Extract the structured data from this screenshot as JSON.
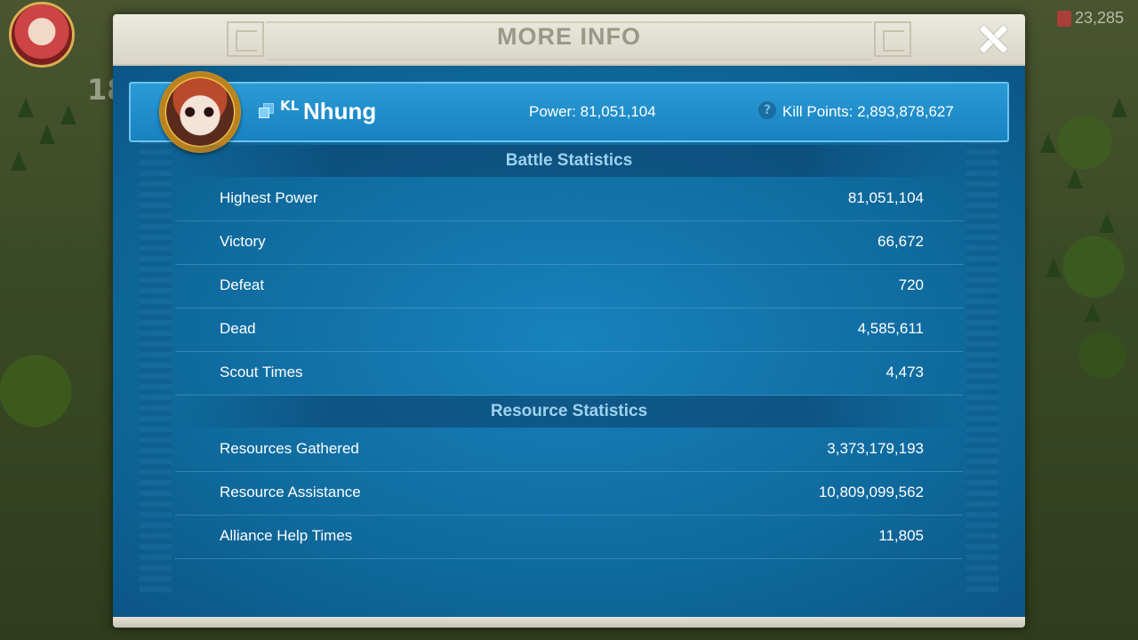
{
  "hud": {
    "level": "18",
    "gems": "23,285"
  },
  "modal": {
    "title": "MORE INFO"
  },
  "player": {
    "alliance_tag": "KL",
    "name": "Nhung",
    "power": "Power: 81,051,104",
    "kill_points": "Kill Points: 2,893,878,627"
  },
  "battle": {
    "heading": "Battle Statistics",
    "rows": [
      {
        "label": "Highest Power",
        "value": "81,051,104"
      },
      {
        "label": "Victory",
        "value": "66,672"
      },
      {
        "label": "Defeat",
        "value": "720"
      },
      {
        "label": "Dead",
        "value": "4,585,611"
      },
      {
        "label": "Scout Times",
        "value": "4,473"
      }
    ]
  },
  "resource": {
    "heading": "Resource Statistics",
    "rows": [
      {
        "label": "Resources Gathered",
        "value": "3,373,179,193"
      },
      {
        "label": "Resource Assistance",
        "value": "10,809,099,562"
      },
      {
        "label": "Alliance Help Times",
        "value": "11,805"
      }
    ]
  }
}
